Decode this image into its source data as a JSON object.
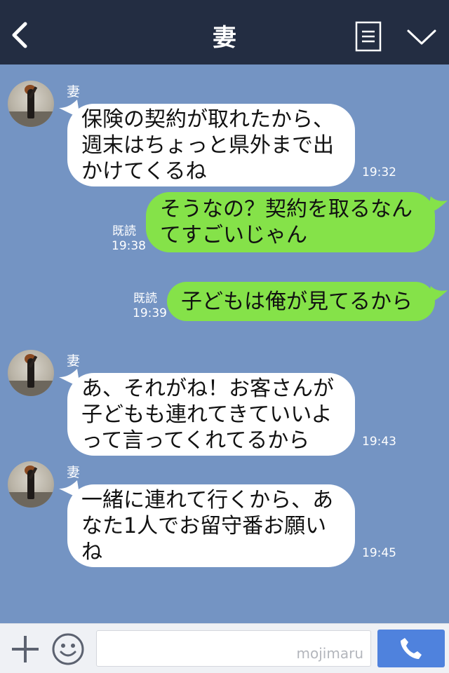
{
  "header": {
    "title": "妻"
  },
  "messages": [
    {
      "sender": "妻",
      "lines": [
        "保険の契約が取れたから、",
        "週末はちょっと県外まで出",
        "かけてくるね"
      ],
      "time": "19:32"
    },
    {
      "lines": [
        "そうなの？契約を取るなん",
        "てすごいじゃん"
      ],
      "read": "既読",
      "time": "19:38"
    },
    {
      "lines": [
        "子どもは俺が見てるから"
      ],
      "read": "既読",
      "time": "19:39"
    },
    {
      "sender": "妻",
      "lines": [
        "あ、それがね！お客さんが",
        "子どもも連れてきていいよ",
        "って言ってくれてるから"
      ],
      "time": "19:43"
    },
    {
      "sender": "妻",
      "lines": [
        "一緒に連れて行くから、あ",
        "なた1人でお留守番お願い",
        "ね"
      ],
      "time": "19:45"
    }
  ],
  "footer": {
    "watermark": "mojimaru"
  },
  "colors": {
    "header_bg": "#232d42",
    "chat_bg": "#7494c3",
    "incoming_bubble": "#ffffff",
    "outgoing_bubble": "#85e249",
    "call_button": "#4f82dd"
  },
  "icons": [
    "back-arrow-icon",
    "menu-list-icon",
    "chevron-down-icon",
    "plus-icon",
    "smiley-icon",
    "phone-icon"
  ]
}
